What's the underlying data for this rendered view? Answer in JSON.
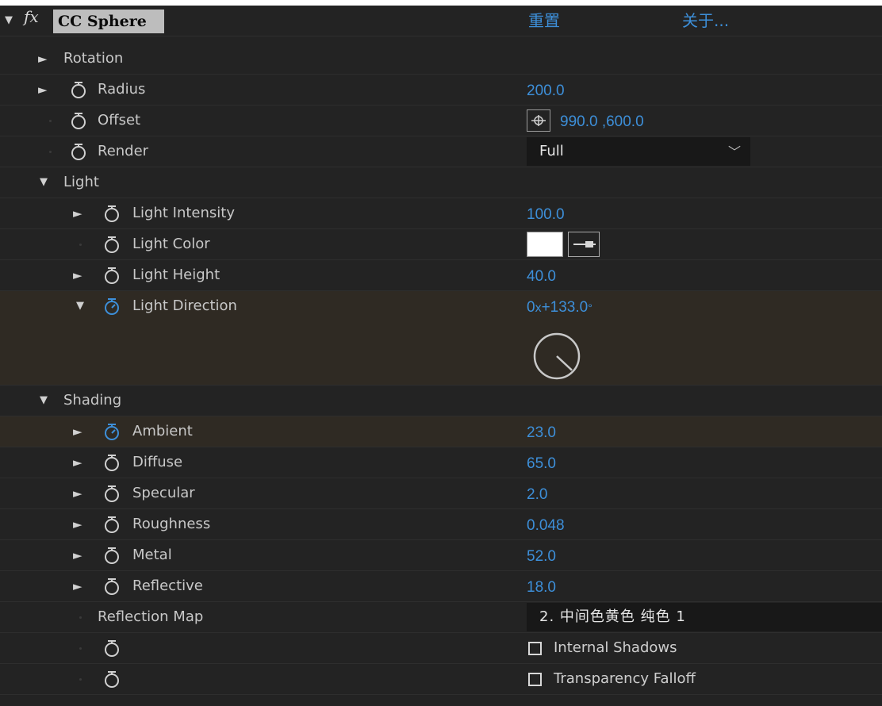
{
  "effect": {
    "name": "CC Sphere",
    "fx_symbol": "fx",
    "reset_label": "重置",
    "about_label": "关于..."
  },
  "rows": {
    "rotation": {
      "label": "Rotation"
    },
    "radius": {
      "label": "Radius",
      "value": "200.0"
    },
    "offset": {
      "label": "Offset",
      "value": "990.0 ,600.0"
    },
    "render": {
      "label": "Render",
      "value": "Full"
    },
    "light": {
      "label": "Light"
    },
    "light_intensity": {
      "label": "Light Intensity",
      "value": "100.0"
    },
    "light_color": {
      "label": "Light Color",
      "color": "#ffffff"
    },
    "light_height": {
      "label": "Light Height",
      "value": "40.0"
    },
    "light_direction": {
      "label": "Light Direction",
      "revolutions": "0",
      "x": "x",
      "degrees": "+133.0",
      "deg_symbol": "°"
    },
    "shading": {
      "label": "Shading"
    },
    "ambient": {
      "label": "Ambient",
      "value": "23.0"
    },
    "diffuse": {
      "label": "Diffuse",
      "value": "65.0"
    },
    "specular": {
      "label": "Specular",
      "value": "2.0"
    },
    "roughness": {
      "label": "Roughness",
      "value": "0.048"
    },
    "metal": {
      "label": "Metal",
      "value": "52.0"
    },
    "reflective": {
      "label": "Reflective",
      "value": "18.0"
    },
    "reflection_map": {
      "label": "Reflection Map",
      "value": "2. 中间色黄色 纯色 1"
    },
    "internal_shadows": {
      "label": "Internal Shadows",
      "checked": false
    },
    "transparency_falloff": {
      "label": "Transparency Falloff",
      "checked": false
    }
  },
  "colors": {
    "value_blue": "#3d8fd9",
    "panel_bg": "#232323",
    "selected_row_bg": "#2f2a23"
  }
}
